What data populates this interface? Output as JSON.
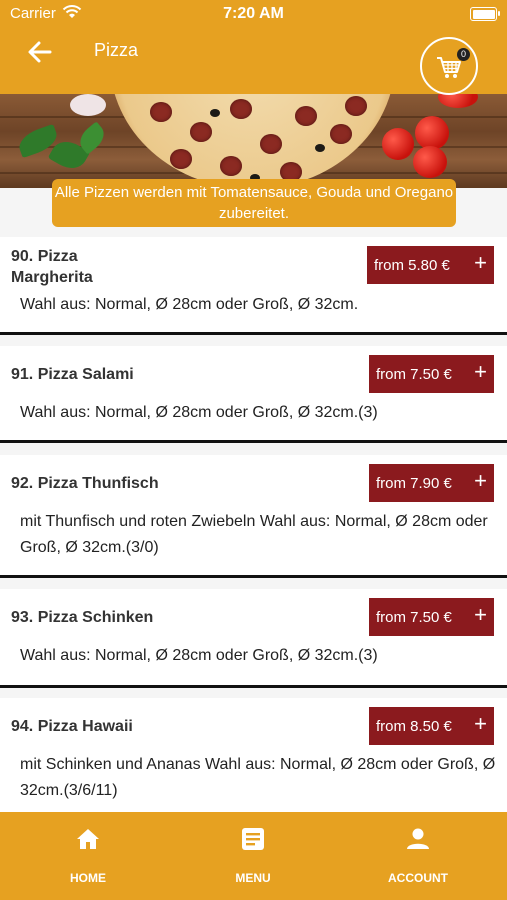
{
  "status_bar": {
    "carrier": "Carrier",
    "time": "7:20 AM"
  },
  "header": {
    "title": "Pizza",
    "cart_count": "0"
  },
  "notice": "Alle Pizzen werden mit Tomatensauce, Gouda und Oregano zubereitet.",
  "items": [
    {
      "name": "90. Pizza Margherita",
      "price": "from 5.80 €",
      "plus": "+",
      "description": "Wahl aus: Normal, Ø 28cm oder Groß, Ø 32cm."
    },
    {
      "name": "91. Pizza Salami",
      "price": "from 7.50 €",
      "plus": "+",
      "description": "Wahl aus: Normal, Ø 28cm oder Groß, Ø 32cm.(3)"
    },
    {
      "name": "92. Pizza Thunfisch",
      "price": "from 7.90 €",
      "plus": "+",
      "description": "mit Thunfisch und roten Zwiebeln  Wahl aus: Normal, Ø 28cm oder Groß, Ø 32cm.(3/0)"
    },
    {
      "name": "93. Pizza Schinken",
      "price": "from 7.50 €",
      "plus": "+",
      "description": "Wahl aus: Normal, Ø 28cm oder Groß, Ø 32cm.(3)"
    },
    {
      "name": "94. Pizza Hawaii",
      "price": "from 8.50 €",
      "plus": "+",
      "description": "mit Schinken und Ananas  Wahl aus: Normal, Ø 28cm oder Groß, Ø 32cm.(3/6/11)"
    }
  ],
  "bottom_nav": [
    {
      "label": "HOME",
      "icon": "home-icon"
    },
    {
      "label": "MENU",
      "icon": "menu-icon"
    },
    {
      "label": "ACCOUNT",
      "icon": "account-icon"
    }
  ],
  "colors": {
    "brand": "#e6a121",
    "price_button": "#8b1a1e",
    "text": "#222222"
  }
}
